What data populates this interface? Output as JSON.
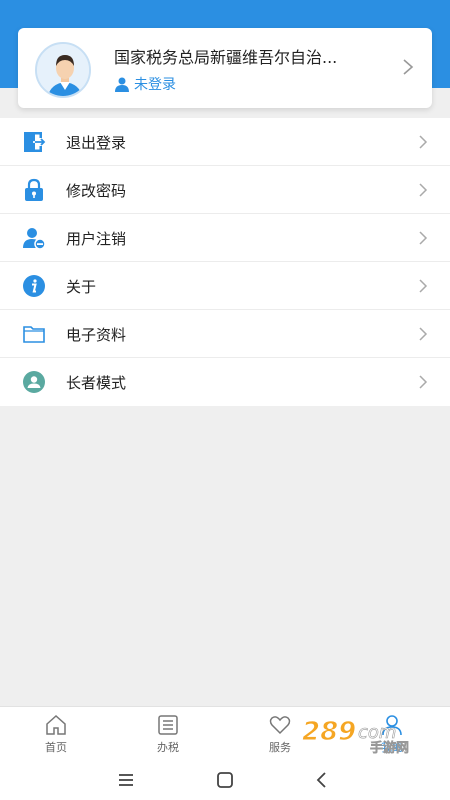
{
  "profile": {
    "org_name": "国家税务总局新疆维吾尔自治...",
    "login_status": "未登录",
    "avatar_icon": "person-avatar-icon"
  },
  "menu": {
    "items": [
      {
        "label": "退出登录",
        "icon": "logout-door-icon"
      },
      {
        "label": "修改密码",
        "icon": "lock-icon"
      },
      {
        "label": "用户注销",
        "icon": "user-remove-icon"
      },
      {
        "label": "关于",
        "icon": "info-icon"
      },
      {
        "label": "电子资料",
        "icon": "folder-icon"
      },
      {
        "label": "长者模式",
        "icon": "elder-mode-icon"
      }
    ]
  },
  "tabbar": {
    "tabs": [
      {
        "label": "首页",
        "icon": "home-icon"
      },
      {
        "label": "办税",
        "icon": "list-icon"
      },
      {
        "label": "服务",
        "icon": "heart-icon"
      },
      {
        "label": "我的",
        "icon": "person-icon"
      }
    ],
    "active": "我的"
  },
  "watermark": {
    "text": "289.com 手游网"
  },
  "colors": {
    "accent": "#2b8fe2",
    "background": "#efefef"
  }
}
